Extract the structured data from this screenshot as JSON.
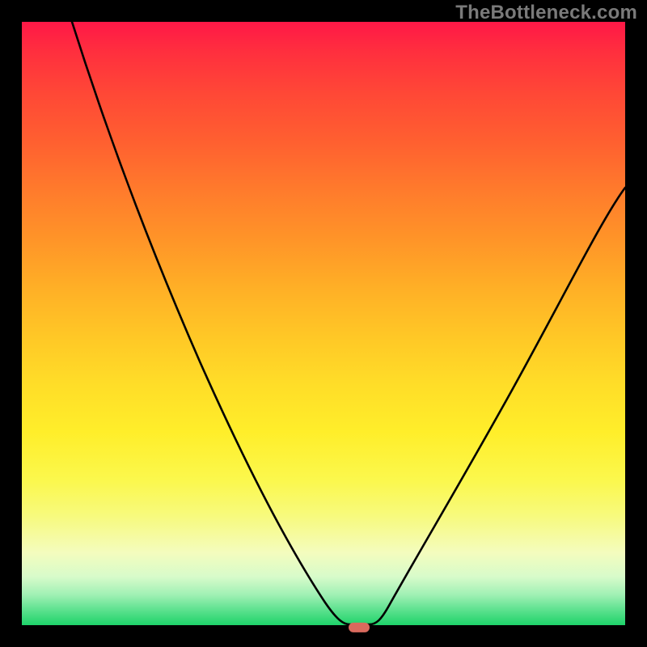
{
  "watermark": "TheBottleneck.com",
  "colors": {
    "frame_bg": "#000000",
    "watermark_text": "#7a7a7a",
    "curve_stroke": "#000000",
    "marker_fill": "#d96a5d",
    "gradient_top": "#ff1847",
    "gradient_bottom": "#1ed36a"
  },
  "chart_data": {
    "type": "line",
    "title": "",
    "xlabel": "",
    "ylabel": "",
    "xlim": [
      0,
      100
    ],
    "ylim": [
      0,
      100
    ],
    "grid": false,
    "legend": false,
    "note": "V-shaped bottleneck curve on rainbow heat gradient; lower is better. Values of y are approximate percentage bottleneck read from vertical position. Minimum marked by pill.",
    "x": [
      0,
      5,
      10,
      15,
      20,
      25,
      30,
      35,
      40,
      45,
      48,
      51,
      54,
      56,
      58,
      60,
      65,
      70,
      75,
      80,
      85,
      90,
      95,
      100
    ],
    "y": [
      100,
      91,
      82,
      73,
      64,
      56,
      47,
      38,
      29,
      18,
      10,
      3,
      0,
      0,
      1,
      5,
      15,
      26,
      36,
      45,
      53,
      60,
      66,
      71
    ],
    "min_marker": {
      "x": 55,
      "y": 0
    }
  }
}
